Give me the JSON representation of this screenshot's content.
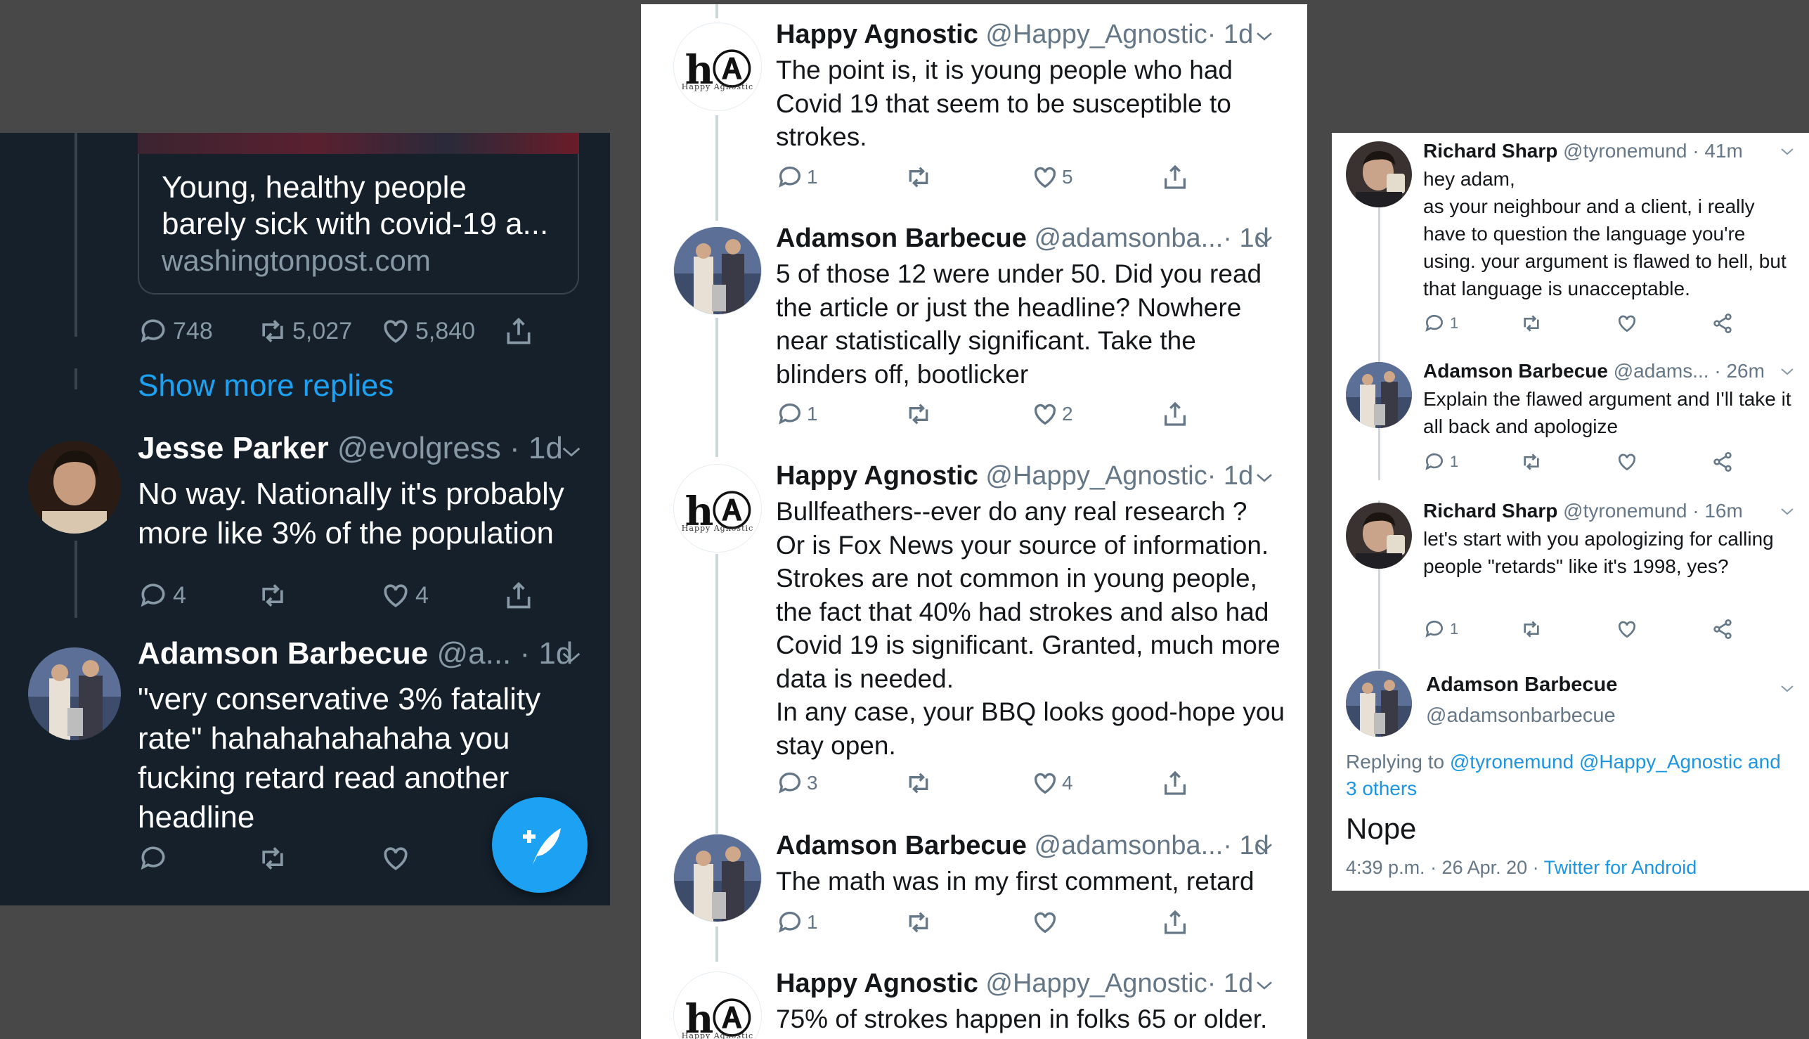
{
  "panel1": {
    "card": {
      "title": "Young, healthy people barely sick with covid-19 a...",
      "domain": "washingtonpost.com"
    },
    "card_actions": {
      "replies": "748",
      "retweets": "5,027",
      "likes": "5,840"
    },
    "show_more": "Show more replies",
    "tweets": [
      {
        "name": "Jesse Parker",
        "handle": "@evolgress",
        "time": "· 1d",
        "text": "No way. Nationally it's probably more like 3% of the population",
        "replies": "4",
        "retweets": "",
        "likes": "4"
      },
      {
        "name": "Adamson Barbecue",
        "handle": "@a...",
        "time": "· 1d",
        "text": "\"very conservative 3% fatality rate\" hahahahahahaha you fucking retard read another headline",
        "replies": "",
        "retweets": "",
        "likes": ""
      }
    ],
    "fab_icon": "compose-tweet-icon",
    "accent": "#1da1f2",
    "background": "#15202b"
  },
  "panel2": {
    "tweets": [
      {
        "name": "Happy Agnostic",
        "handle": "@Happy_Agnostic",
        "time": "· 1d",
        "text": "The point is, it is young people who had Covid 19 that seem to be susceptible to strokes.",
        "replies": "1",
        "retweets": "",
        "likes": "5"
      },
      {
        "name": "Adamson Barbecue",
        "handle": "@adamsonba...",
        "time": "· 1d",
        "text": "5 of those 12 were under 50. Did you read the article or just the headline? Nowhere near statistically significant. Take the blinders off, bootlicker",
        "replies": "1",
        "retweets": "",
        "likes": "2"
      },
      {
        "name": "Happy Agnostic",
        "handle": "@Happy_Agnostic",
        "time": "· 1d",
        "text": "Bullfeathers--ever do any real research ?\nOr is Fox News your source of information. Strokes are not common in young people, the fact that 40% had strokes and also had Covid 19 is significant. Granted, much more data is needed.\nIn any case, your BBQ looks good-hope you stay open.",
        "replies": "3",
        "retweets": "",
        "likes": "4"
      },
      {
        "name": "Adamson Barbecue",
        "handle": "@adamsonba...",
        "time": "· 1d",
        "text": "The math was in my first comment, retard",
        "replies": "1",
        "retweets": "",
        "likes": ""
      },
      {
        "name": "Happy Agnostic",
        "handle": "@Happy_Agnostic",
        "time": "· 1d",
        "text": "75% of strokes happen in folks 65 or older."
      }
    ],
    "logo_text": "hⒶ",
    "logo_sub": "Happy Agnostic"
  },
  "panel3": {
    "tweets": [
      {
        "name": "Richard Sharp",
        "handle": "@tyronemund",
        "time": "· 41m",
        "text": "hey adam,\nas your neighbour and a client, i really have to question the language you're using. your argument is flawed to hell, but that language is unacceptable.",
        "replies": "1"
      },
      {
        "name": "Adamson Barbecue",
        "handle": "@adams...",
        "time": "· 26m",
        "text": "Explain the flawed argument and I'll take it all back and apologize",
        "replies": "1"
      },
      {
        "name": "Richard Sharp",
        "handle": "@tyronemund",
        "time": "· 16m",
        "text": "let's start with you apologizing for calling people \"retards\" like it's 1998, yes?",
        "replies": "1"
      }
    ],
    "main": {
      "name": "Adamson Barbecue",
      "handle": "@adamsonbarbecue",
      "replying_prefix": "Replying to",
      "replying_links": "@tyronemund @Happy_Agnostic and 3 others",
      "text": "Nope",
      "timestamp": "4:39 p.m. · 26 Apr. 20 ·",
      "client": "Twitter for Android"
    }
  }
}
